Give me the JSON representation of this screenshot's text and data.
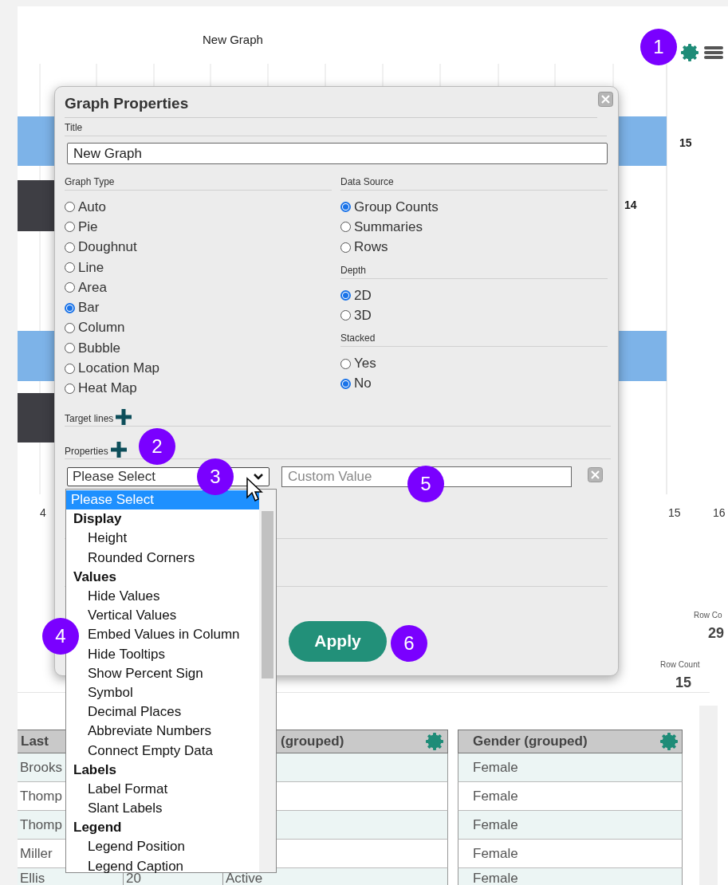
{
  "chart": {
    "title": "New Graph",
    "bars": [
      {
        "color": "#7db3e8",
        "value_label": "15"
      },
      {
        "color": "#3e3e44",
        "value_label": "14"
      },
      {
        "color": "#7db3e8"
      },
      {
        "color": "#3e3e44"
      }
    ],
    "axis_labels": [
      "4",
      "15",
      "16"
    ]
  },
  "summary": [
    {
      "label": "Row Co",
      "value": "29"
    },
    {
      "label": "Row Count",
      "value": "15"
    }
  ],
  "table": {
    "columns": [
      {
        "label": "Last",
        "settings": false
      },
      {},
      {
        "label": "(grouped)",
        "settings": true
      },
      {
        "label": "Gender (grouped)",
        "settings": true
      }
    ],
    "rows": [
      [
        "Brooks",
        null,
        null,
        "Female"
      ],
      [
        "Thomp",
        null,
        null,
        "Female"
      ],
      [
        "Thomp",
        null,
        null,
        "Female"
      ],
      [
        "Miller",
        null,
        null,
        "Female"
      ],
      [
        "Ellis",
        "20",
        "Active",
        "Female"
      ]
    ]
  },
  "dialog": {
    "title": "Graph Properties",
    "title_field": {
      "label": "Title",
      "value": "New Graph"
    },
    "graph_type": {
      "label": "Graph Type",
      "options": [
        {
          "label": "Auto",
          "selected": false
        },
        {
          "label": "Pie",
          "selected": false
        },
        {
          "label": "Doughnut",
          "selected": false
        },
        {
          "label": "Line",
          "selected": false
        },
        {
          "label": "Area",
          "selected": false
        },
        {
          "label": "Bar",
          "selected": true
        },
        {
          "label": "Column",
          "selected": false
        },
        {
          "label": "Bubble",
          "selected": false
        },
        {
          "label": "Location Map",
          "selected": false
        },
        {
          "label": "Heat Map",
          "selected": false
        }
      ]
    },
    "right_groups": [
      {
        "label": "Data Source",
        "options": [
          {
            "label": "Group Counts",
            "selected": true
          },
          {
            "label": "Summaries",
            "selected": false
          },
          {
            "label": "Rows",
            "selected": false
          }
        ]
      },
      {
        "label": "Depth",
        "options": [
          {
            "label": "2D",
            "selected": true
          },
          {
            "label": "3D",
            "selected": false
          }
        ]
      },
      {
        "label": "Stacked",
        "options": [
          {
            "label": "Yes",
            "selected": false
          },
          {
            "label": "No",
            "selected": true
          }
        ]
      }
    ],
    "target_lines": {
      "label": "Target lines"
    },
    "properties": {
      "label": "Properties",
      "select": {
        "value": "Please Select",
        "expanded": true
      },
      "custom_value": {
        "placeholder": "Custom Value"
      }
    },
    "apply_button": "Apply"
  },
  "dropdown": {
    "options": [
      {
        "label": "Please Select",
        "kind": "option",
        "selected": true
      },
      {
        "label": "Display",
        "kind": "group",
        "selected": false
      },
      {
        "label": "Height",
        "kind": "option",
        "selected": false
      },
      {
        "label": "Rounded Corners",
        "kind": "option",
        "selected": false
      },
      {
        "label": "Values",
        "kind": "group",
        "selected": false
      },
      {
        "label": "Hide Values",
        "kind": "option",
        "selected": false
      },
      {
        "label": "Vertical Values",
        "kind": "option",
        "selected": false
      },
      {
        "label": "Embed Values in Column",
        "kind": "option",
        "selected": false
      },
      {
        "label": "Hide Tooltips",
        "kind": "option",
        "selected": false
      },
      {
        "label": "Show Percent Sign",
        "kind": "option",
        "selected": false
      },
      {
        "label": "Symbol",
        "kind": "option",
        "selected": false
      },
      {
        "label": "Decimal Places",
        "kind": "option",
        "selected": false
      },
      {
        "label": "Abbreviate Numbers",
        "kind": "option",
        "selected": false
      },
      {
        "label": "Connect Empty Data",
        "kind": "option",
        "selected": false
      },
      {
        "label": "Labels",
        "kind": "group",
        "selected": false
      },
      {
        "label": "Label Format",
        "kind": "option",
        "selected": false
      },
      {
        "label": "Slant Labels",
        "kind": "option",
        "selected": false
      },
      {
        "label": "Legend",
        "kind": "group",
        "selected": false
      },
      {
        "label": "Legend Position",
        "kind": "option",
        "selected": false
      },
      {
        "label": "Legend Caption",
        "kind": "option",
        "selected": false
      }
    ]
  },
  "badges": [
    "1",
    "2",
    "3",
    "4",
    "5",
    "6"
  ]
}
